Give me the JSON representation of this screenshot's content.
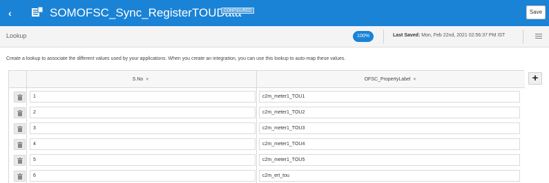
{
  "header": {
    "back_label": "‹",
    "title": "SOMOFSC_Sync_RegisterTOUData",
    "badge": "CONFIGURED",
    "save_label": "Save",
    "app_icon": "lookup-icon"
  },
  "subheader": {
    "breadcrumb": "Lookup",
    "percent": "100%",
    "last_saved_label": "Last Saved:",
    "last_saved_value": "Mon, Feb 22nd, 2021 02:56:37 PM IST",
    "menu_icon": "hamburger-icon"
  },
  "description": "Create a lookup to associate the different values used by your applications. When you create an integration, you can use this lookup to auto-map these values.",
  "table": {
    "columns": [
      {
        "label": "S.No"
      },
      {
        "label": "OFSC_PropertyLabel"
      }
    ],
    "sort_glyph": "▼",
    "rows": [
      {
        "sno": "1",
        "label": "c2m_meter1_TOU1"
      },
      {
        "sno": "2",
        "label": "c2m_meter1_TOU2"
      },
      {
        "sno": "3",
        "label": "c2m_meter1_TOU3"
      },
      {
        "sno": "4",
        "label": "c2m_meter1_TOU4"
      },
      {
        "sno": "5",
        "label": "c2m_meter1_TOU5"
      },
      {
        "sno": "6",
        "label": "c2m_ert_tou"
      }
    ],
    "delete_icon": "trash-icon",
    "add_label": "+"
  },
  "colors": {
    "header_bg": "#1a83d6",
    "subheader_bg": "#f4f4f4",
    "accent": "#1a83d6"
  }
}
